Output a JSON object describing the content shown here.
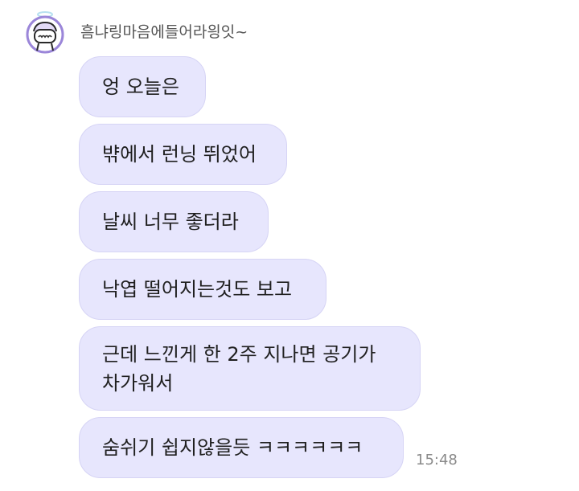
{
  "chat": {
    "sender_name": "흠냐링마음에들어라읭잇~",
    "avatar_icon": "cartoon-face-with-halo-icon",
    "messages": [
      "엉 오늘은",
      "뱎에서 런닝 뛰었어",
      "날씨 너무 좋더라",
      "낙엽 떨어지는것도 보고",
      "근데 느낀게 한 2주 지나면 공기가 차가워서",
      "숨쉬기 쉽지않을듯 ㅋㅋㅋㅋㅋㅋ"
    ],
    "timestamp": "15:48"
  },
  "colors": {
    "bubble_bg": "#e7e6fd",
    "avatar_accent": "#9b86d9",
    "timestamp": "#8a8a8a"
  }
}
